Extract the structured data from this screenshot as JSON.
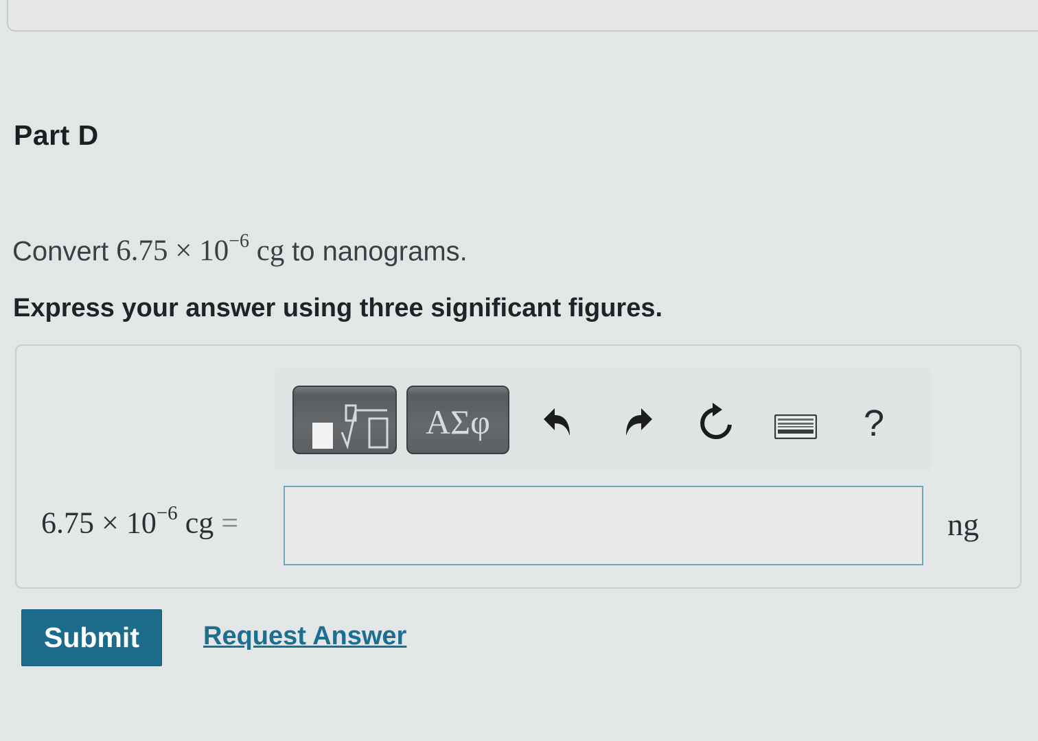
{
  "part": {
    "title": "Part D"
  },
  "question": {
    "prefix": "Convert",
    "mantissa": "6.75",
    "times": "×",
    "base": "10",
    "exponent": "−6",
    "unit_from": "cg",
    "suffix": "to nanograms."
  },
  "instruction": "Express your answer using three significant figures.",
  "toolbar": {
    "symbols_label": "ΑΣφ",
    "help_label": "?",
    "icons": [
      "templates-icon",
      "greek-symbols-icon",
      "undo-icon",
      "redo-icon",
      "reset-icon",
      "keyboard-icon",
      "help-icon"
    ]
  },
  "answer": {
    "lhs_mantissa": "6.75",
    "lhs_times": "×",
    "lhs_base": "10",
    "lhs_exponent": "−6",
    "lhs_unit": "cg",
    "equals": "=",
    "value": "",
    "unit": "ng"
  },
  "actions": {
    "submit_label": "Submit",
    "request_label": "Request Answer"
  },
  "colors": {
    "background": "#e3e6e6",
    "submit": "#1b6b8b",
    "link": "#1d6f90",
    "input_border": "#6fa6b8"
  }
}
